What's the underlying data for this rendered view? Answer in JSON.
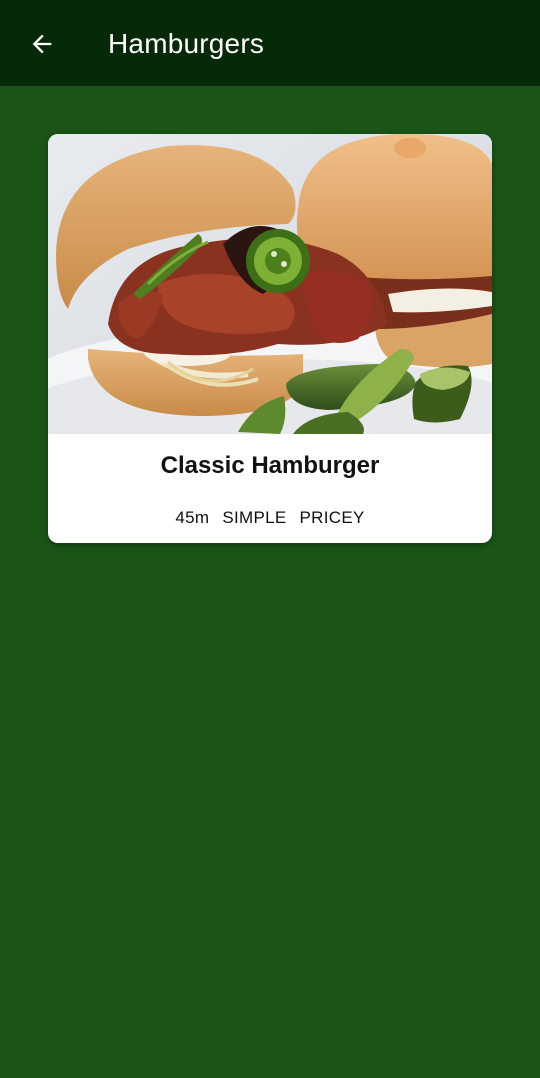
{
  "theme": {
    "primary": "#1a5417",
    "app_bar": "#062a07"
  },
  "app_bar": {
    "title": "Hamburgers",
    "back_icon": "arrow-left-icon"
  },
  "meals": [
    {
      "title": "Classic Hamburger",
      "image": "burger-photo",
      "duration": "45m",
      "complexity": "SIMPLE",
      "affordability": "PRICEY"
    }
  ]
}
